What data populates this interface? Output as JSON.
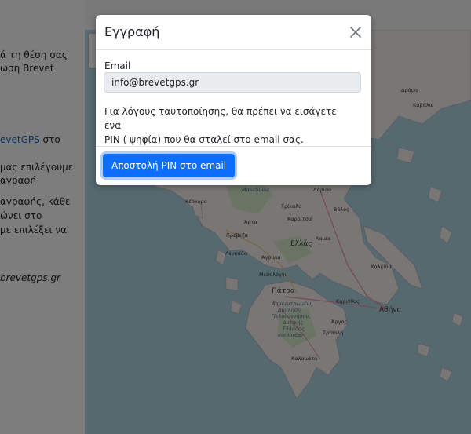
{
  "background": {
    "left_panel": {
      "line1": "ά τη θέση σας",
      "line2": "ωση Brevet",
      "link_text": "evetGPS",
      "link_suffix": " στο",
      "line4": "μας επιλέγουμε",
      "line5": "αγραφή",
      "line6": "αγραφής, κάθε",
      "line7": "ώνει στο",
      "line8": "με επιλέξει να",
      "line9": "brevetgps.gr"
    },
    "map_labels": {
      "greece": "Ελλάς",
      "larisa": "Λάρισα",
      "volos": "Βόλος",
      "trikala": "Τρίκαλα",
      "karditsa": "Καρδίτσα",
      "kerkyra": "Κέρκυρα",
      "arta": "Άρτα",
      "preveza": "Πρέβεζα",
      "lefkada": "Λευκάδα",
      "agrinio": "Αγρίνιο",
      "lamia": "Λαμία",
      "mesolongi": "Μεσολόγγι",
      "patra": "Πάτρα",
      "korinthos": "Κόρινθος",
      "athina": "Αθήνα",
      "chalkida": "Χαλκίδα",
      "argos": "Άργος",
      "tripoli": "Τρίπολη",
      "kalamata": "Καλαμάτα",
      "drama": "Δράμα",
      "kavala": "Καβάλα",
      "makedonia": "Μακεδονία",
      "region_peloponnisos_1": "Αποκεντρωμένη",
      "region_peloponnisos_2": "Διοίκηση",
      "region_peloponnisos_3": "Πελοποννήσου,",
      "region_peloponnisos_4": "Δυτικής",
      "region_peloponnisos_5": "Ελλάδος",
      "region_peloponnisos_6": "και Ιονίου"
    }
  },
  "modal": {
    "title": "Εγγραφή",
    "close_icon": "close-icon",
    "email_label": "Email",
    "email_value": "info@brevetgps.gr",
    "info_line1": "Για λόγους ταυτοποίησης, θα πρέπει να εισάγετε ένα",
    "info_line2": "PIN ( ψηφία) που θα σταλεί στο email σας.",
    "send_button": "Αποστολή PIN στο email"
  },
  "colors": {
    "overlay": "#000000",
    "primary": "#0d6efd",
    "input_bg": "#e9ecef",
    "sea": "#aad3df",
    "land": "#f2efe9"
  }
}
